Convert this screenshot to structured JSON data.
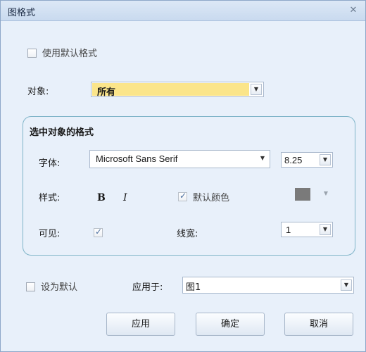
{
  "window": {
    "title": "图格式",
    "close_glyph": "✕"
  },
  "use_default_format": {
    "label": "使用默认格式",
    "checked": false
  },
  "object": {
    "label": "对象:",
    "value": "所有",
    "highlight_color": "#fbe58a"
  },
  "group": {
    "title": "选中对象的格式",
    "font_label": "字体:",
    "font_value": "Microsoft Sans Serif",
    "font_size_value": "8.25",
    "style_label": "样式:",
    "bold_label": "B",
    "italic_label": "I",
    "default_color_label": "默认颜色",
    "default_color_checked": true,
    "color_swatch": "#7a7a7a",
    "visible_label": "可见:",
    "visible_checked": true,
    "line_width_label": "线宽:",
    "line_width_value": "1"
  },
  "set_default": {
    "label": "设为默认",
    "checked": false
  },
  "apply_to": {
    "label": "应用于:",
    "value": "图1"
  },
  "buttons": {
    "apply": "应用",
    "ok": "确定",
    "cancel": "取消"
  }
}
